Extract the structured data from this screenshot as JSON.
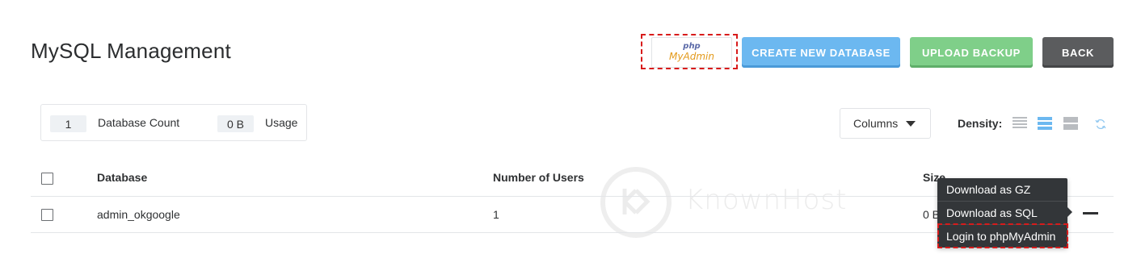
{
  "page": {
    "title": "MySQL Management"
  },
  "header": {
    "phpmyadmin_logo": {
      "php": "php",
      "myadmin": "MyAdmin"
    },
    "create_label": "CREATE NEW DATABASE",
    "upload_label": "UPLOAD BACKUP",
    "back_label": "BACK"
  },
  "stats": {
    "database_count_value": "1",
    "database_count_label": "Database Count",
    "usage_value": "0 B",
    "usage_label": "Usage"
  },
  "toolbar": {
    "columns_label": "Columns",
    "density_label": "Density:"
  },
  "table": {
    "headers": [
      "Database",
      "Number of Users",
      "Size"
    ],
    "rows": [
      {
        "database": "admin_okgoogle",
        "users": "1",
        "size": "0 B"
      }
    ]
  },
  "row_menu": {
    "items": [
      "Download as GZ",
      "Download as SQL",
      "Login to phpMyAdmin"
    ]
  },
  "watermark": {
    "text": "KnownHost"
  },
  "colors": {
    "create_button": "#6cb8f0",
    "upload_button": "#7fcf89",
    "back_button": "#5b5c5e",
    "menu_bg": "#333639",
    "highlight": "#d81b1b",
    "density_active": "#6cb8f0"
  },
  "icons": {
    "columns_caret": "caret-down-icon",
    "density_compact": "density-compact-icon",
    "density_standard": "density-standard-icon",
    "density_comfortable": "density-comfortable-icon",
    "refresh": "refresh-icon",
    "row_action": "dash-icon"
  }
}
